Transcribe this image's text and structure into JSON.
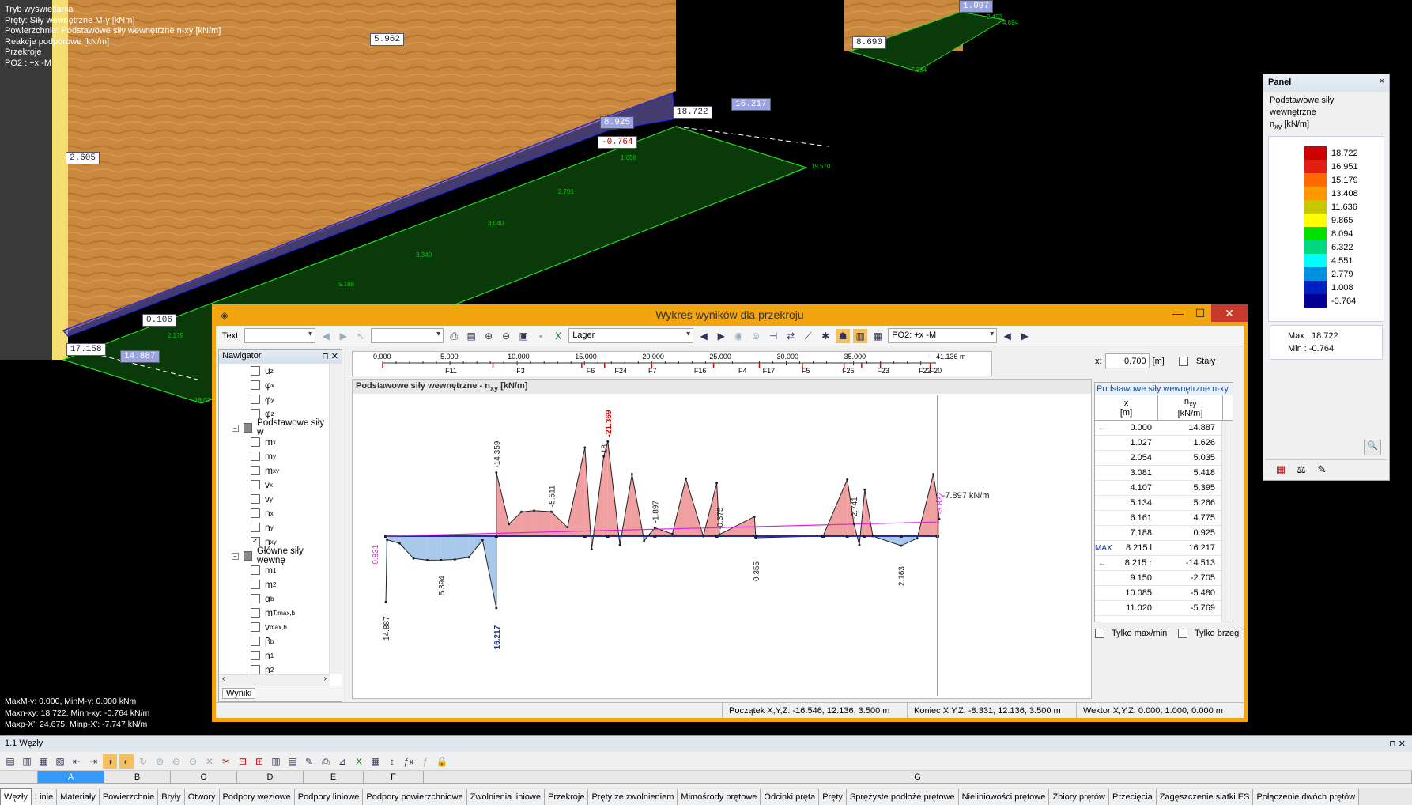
{
  "viewport": {
    "overlay_lines": [
      "Tryb wyświetlania",
      "Pręty: Siły wewnętrzne M-y [kNm]",
      "Powierzchnie: Podstawowe siły wewnętrzne n-xy [kN/m]",
      "Reakcje podporowe [kN/m]",
      "Przekroje",
      "PO2 : +x -M"
    ],
    "bottom_lines": [
      "MaxM-y: 0.000, MinM-y: 0.000 kNm",
      "Maxn-xy: 18.722, Minn-xy: -0.764 kN/m",
      "Maxp-X': 24.675, Minp-X': -7.747 kN/m"
    ],
    "labels": [
      "5.962",
      "2.605",
      "0.106",
      "17.158",
      "14.887",
      "18.722",
      "-0.764",
      "8.925",
      "16.217",
      "8.690",
      "1.097"
    ],
    "green_labels": [
      "19.570",
      "1.658",
      "2.701",
      "3.040",
      "3.340",
      "5.188",
      "2.179",
      "18.07",
      "7.334",
      "2.453",
      "4.894"
    ]
  },
  "panel": {
    "header": "Panel",
    "title_line1": "Podstawowe siły wewnętrzne",
    "title_line2": "n",
    "title_sub": "xy",
    "title_unit": " [kN/m]",
    "legend": [
      {
        "value": "18.722",
        "color": "#cc0000"
      },
      {
        "value": "16.951",
        "color": "#e02010"
      },
      {
        "value": "15.179",
        "color": "#ff6a00"
      },
      {
        "value": "13.408",
        "color": "#ff9900"
      },
      {
        "value": "11.636",
        "color": "#c8c800"
      },
      {
        "value": "9.865",
        "color": "#ffff00"
      },
      {
        "value": "8.094",
        "color": "#00e000"
      },
      {
        "value": "6.322",
        "color": "#00d880"
      },
      {
        "value": "4.551",
        "color": "#00ffff"
      },
      {
        "value": "2.779",
        "color": "#0090e0"
      },
      {
        "value": "1.008",
        "color": "#0020c0"
      },
      {
        "value": "-0.764",
        "color": "#000090"
      }
    ],
    "max_label": "Max  :  18.722",
    "min_label": "Min   :  -0.764"
  },
  "dialog": {
    "title": "Wykres wyników dla przekroju",
    "text_label": "Text",
    "combo_lager": "Lager",
    "combo_po": "PO2: +x -M",
    "x_label": "x:",
    "x_value": "0.700",
    "x_unit": "[m]",
    "staly_label": "Stały",
    "chart_title": "Podstawowe siły wewnętrzne - n",
    "chart_title_sub": "xy",
    "chart_title_unit": " [kN/m]",
    "cursor_label": "-7.897 kN/m",
    "status_start": "Początek X,Y,Z:   -16.546, 12.136, 3.500 m",
    "status_end": "Koniec X,Y,Z:   -8.331, 12.136, 3.500 m",
    "status_vec": "Wektor X,Y,Z:   0.000, 1.000, 0.000 m",
    "check_maxmin": "Tylko max/min",
    "check_edges": "Tylko brzegi"
  },
  "navigator": {
    "header": "Nawigator",
    "tab": "Wyniki",
    "items": [
      {
        "label": "u",
        "sub": "z",
        "checked": false,
        "group": false
      },
      {
        "label": "φ",
        "sub": "x",
        "checked": false,
        "group": false
      },
      {
        "label": "φ",
        "sub": "y",
        "checked": false,
        "group": false
      },
      {
        "label": "φ",
        "sub": "z",
        "checked": false,
        "group": false
      },
      {
        "label": "Podstawowe siły w",
        "sub": "",
        "checked": false,
        "group": true
      },
      {
        "label": "m",
        "sub": "x",
        "checked": false,
        "group": false
      },
      {
        "label": "m",
        "sub": "y",
        "checked": false,
        "group": false
      },
      {
        "label": "m",
        "sub": "xy",
        "checked": false,
        "group": false
      },
      {
        "label": "v",
        "sub": "x",
        "checked": false,
        "group": false
      },
      {
        "label": "v",
        "sub": "y",
        "checked": false,
        "group": false
      },
      {
        "label": "n",
        "sub": "x",
        "checked": false,
        "group": false
      },
      {
        "label": "n",
        "sub": "y",
        "checked": false,
        "group": false
      },
      {
        "label": "n",
        "sub": "xy",
        "checked": true,
        "group": false
      },
      {
        "label": "Główne siły wewnę",
        "sub": "",
        "checked": false,
        "group": true
      },
      {
        "label": "m",
        "sub": "1",
        "checked": false,
        "group": false
      },
      {
        "label": "m",
        "sub": "2",
        "checked": false,
        "group": false
      },
      {
        "label": "α",
        "sub": "b",
        "checked": false,
        "group": false
      },
      {
        "label": "m",
        "sub": "T,max,b",
        "checked": false,
        "group": false
      },
      {
        "label": "v",
        "sub": "max,b",
        "checked": false,
        "group": false
      },
      {
        "label": "β",
        "sub": "b",
        "checked": false,
        "group": false
      },
      {
        "label": "n",
        "sub": "1",
        "checked": false,
        "group": false
      },
      {
        "label": "n",
        "sub": "2",
        "checked": false,
        "group": false
      }
    ]
  },
  "ruler": {
    "ticks": [
      "0.000",
      "5.000",
      "10.000",
      "15.000",
      "20.000",
      "25.000",
      "30.000",
      "35.000",
      "41.136 m"
    ],
    "members": [
      "F11",
      "F3",
      "F6",
      "F24",
      "F7",
      "F16",
      "F4",
      "F17",
      "F5",
      "F25",
      "F23",
      "F22",
      "F20"
    ]
  },
  "results_table": {
    "title": "Podstawowe siły wewnętrzne n-xy",
    "col_x": "x",
    "col_x_unit": "[m]",
    "col_n": "n",
    "col_n_sub": "xy",
    "col_n_unit": "[kN/m]",
    "rows": [
      {
        "mark": "←",
        "x": "0.000",
        "n": "14.887"
      },
      {
        "mark": "",
        "x": "1.027",
        "n": "1.626"
      },
      {
        "mark": "",
        "x": "2.054",
        "n": "5.035"
      },
      {
        "mark": "",
        "x": "3.081",
        "n": "5.418"
      },
      {
        "mark": "",
        "x": "4.107",
        "n": "5.395"
      },
      {
        "mark": "",
        "x": "5.134",
        "n": "5.266"
      },
      {
        "mark": "",
        "x": "6.161",
        "n": "4.775"
      },
      {
        "mark": "",
        "x": "7.188",
        "n": "0.925"
      },
      {
        "mark": "MAX",
        "x": "8.215 l",
        "n": "16.217"
      },
      {
        "mark": "←",
        "x": "8.215 r",
        "n": "-14.513"
      },
      {
        "mark": "",
        "x": "9.150",
        "n": "-2.705"
      },
      {
        "mark": "",
        "x": "10.085",
        "n": "-5.480"
      },
      {
        "mark": "",
        "x": "11.020",
        "n": "-5.769"
      }
    ]
  },
  "chart_data": {
    "type": "area",
    "title": "Podstawowe siły wewnętrzne - nxy [kN/m]",
    "xlabel": "x [m]",
    "ylabel": "nxy [kN/m]",
    "xlim": [
      0,
      41.136
    ],
    "points": [
      {
        "x": 0.0,
        "y": 14.887
      },
      {
        "x": 0.1,
        "y": 0.831
      },
      {
        "x": 1.027,
        "y": 1.626
      },
      {
        "x": 2.054,
        "y": 5.035
      },
      {
        "x": 3.081,
        "y": 5.418
      },
      {
        "x": 4.107,
        "y": 5.394
      },
      {
        "x": 5.134,
        "y": 5.266
      },
      {
        "x": 6.161,
        "y": 4.775
      },
      {
        "x": 7.188,
        "y": 0.925
      },
      {
        "x": 8.215,
        "y": 16.217
      },
      {
        "x": 8.216,
        "y": -14.359
      },
      {
        "x": 9.15,
        "y": -2.705
      },
      {
        "x": 10.085,
        "y": -5.48
      },
      {
        "x": 11.02,
        "y": -5.769
      },
      {
        "x": 12.3,
        "y": -5.511
      },
      {
        "x": 13.5,
        "y": -2.0
      },
      {
        "x": 14.8,
        "y": -20.0
      },
      {
        "x": 15.3,
        "y": 3.0
      },
      {
        "x": 16.2,
        "y": -18.0
      },
      {
        "x": 16.5,
        "y": -21.369
      },
      {
        "x": 17.4,
        "y": 2.0
      },
      {
        "x": 18.3,
        "y": -14.0
      },
      {
        "x": 19.2,
        "y": 1.0
      },
      {
        "x": 20.0,
        "y": -1.897
      },
      {
        "x": 21.3,
        "y": -0.5
      },
      {
        "x": 22.3,
        "y": -13.0
      },
      {
        "x": 23.6,
        "y": 0.0
      },
      {
        "x": 24.6,
        "y": -12.0
      },
      {
        "x": 24.8,
        "y": -0.375
      },
      {
        "x": 27.4,
        "y": -4.4
      },
      {
        "x": 27.5,
        "y": 0.355
      },
      {
        "x": 32.5,
        "y": 0.0
      },
      {
        "x": 34.3,
        "y": -12.8
      },
      {
        "x": 34.8,
        "y": -2.741
      },
      {
        "x": 35.2,
        "y": 2.0
      },
      {
        "x": 35.6,
        "y": -10.5
      },
      {
        "x": 36.2,
        "y": 0.0
      },
      {
        "x": 38.3,
        "y": 2.163
      },
      {
        "x": 39.5,
        "y": 0.5
      },
      {
        "x": 40.7,
        "y": -14.0
      },
      {
        "x": 41.0,
        "y": -7.897
      },
      {
        "x": 41.136,
        "y": -3.832
      }
    ],
    "annotations": [
      "14.887",
      "0.831",
      "5.394",
      "16.217",
      "-14.359",
      "-5.511",
      "18",
      "-21.369",
      "-1.897",
      "-0.375",
      "0.355",
      "-2.741",
      "2.163",
      "-7.897",
      "-3.832"
    ]
  },
  "bottom": {
    "title": "1.1 Węzły",
    "columns": [
      "A",
      "B",
      "C",
      "D",
      "E",
      "F",
      "G"
    ],
    "tabs": [
      "Węzły",
      "Linie",
      "Materiały",
      "Powierzchnie",
      "Bryły",
      "Otwory",
      "Podpory węzłowe",
      "Podpory liniowe",
      "Podpory powierzchniowe",
      "Zwolnienia liniowe",
      "Przekroje",
      "Pręty ze zwolnieniem",
      "Mimośrody prętowe",
      "Odcinki pręta",
      "Pręty",
      "Sprężyste podłoże prętowe",
      "Nieliniowości prętowe",
      "Zbiory prętów",
      "Przecięcia",
      "Zagęszczenie siatki ES",
      "Połączenie dwóch prętów"
    ]
  }
}
